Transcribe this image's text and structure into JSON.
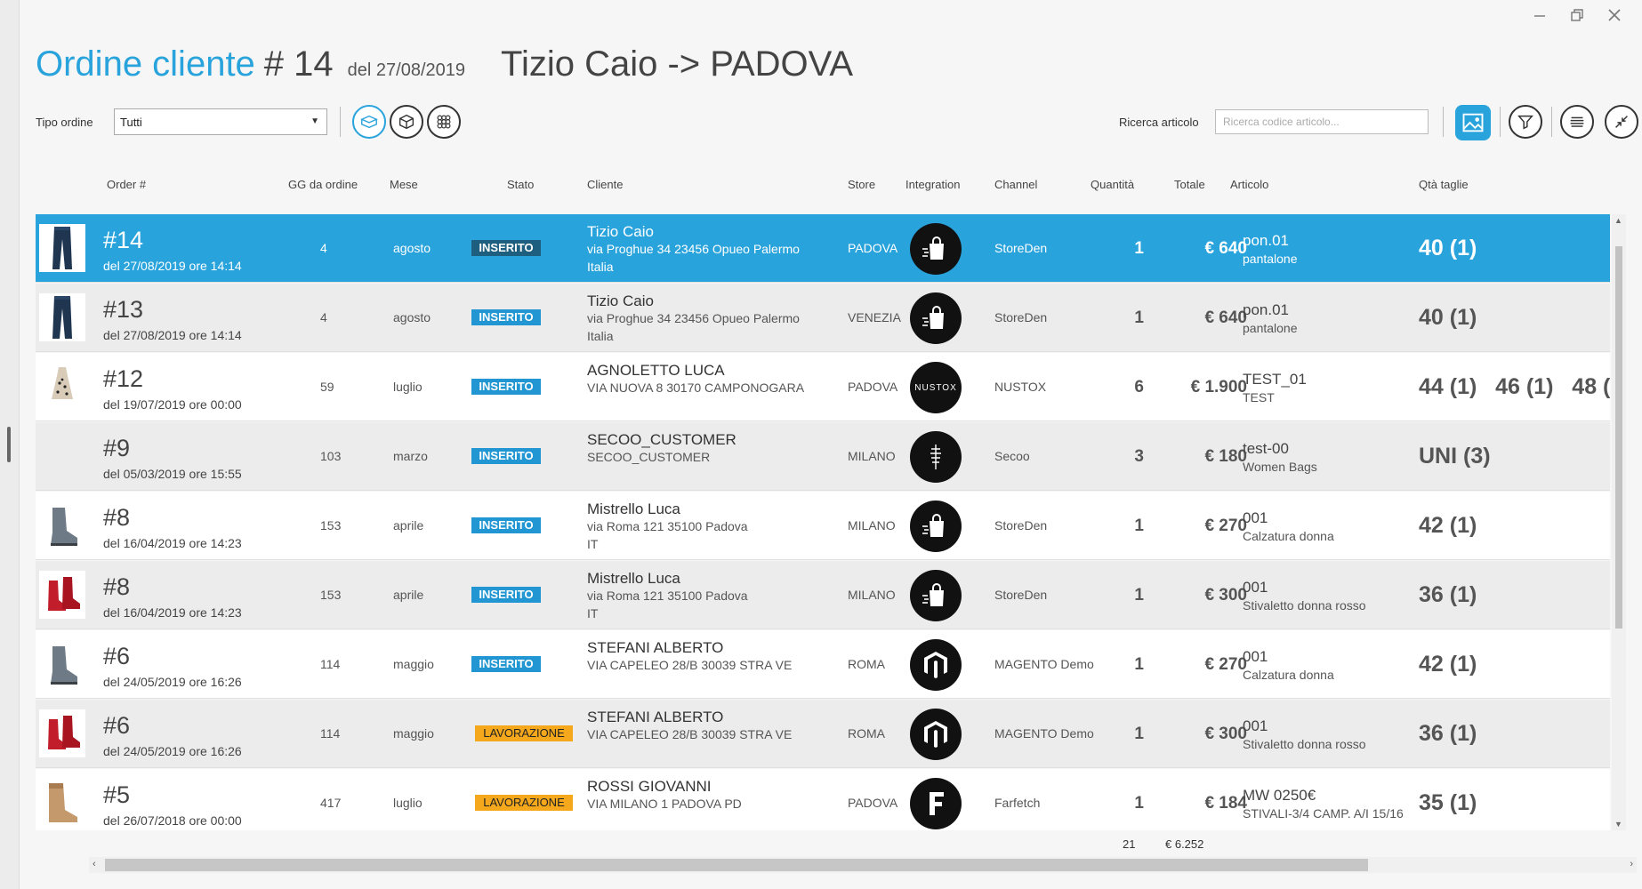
{
  "header": {
    "title": "Ordine cliente",
    "number": "# 14",
    "date": "del 27/08/2019",
    "client": "Tizio Caio -> PADOVA"
  },
  "toolbar": {
    "tipo_label": "Tipo ordine",
    "tipo_value": "Tutti",
    "search_label": "Ricerca articolo",
    "search_placeholder": "Ricerca codice articolo..."
  },
  "columns": {
    "order": "Order #",
    "gg": "GG da ordine",
    "mese": "Mese",
    "stato": "Stato",
    "cliente": "Cliente",
    "store": "Store",
    "integration": "Integration",
    "channel": "Channel",
    "quantita": "Quantità",
    "totale": "Totale",
    "articolo": "Articolo",
    "taglie": "Qtà taglie"
  },
  "rows": [
    {
      "num": "#14",
      "date": "del 27/08/2019 ore 14:14",
      "gg": "4",
      "mese": "agosto",
      "stato": "INSERITO",
      "name": "Tizio Caio",
      "addr": "via Proghue 34 23456 Opueo Palermo",
      "addr2": "Italia",
      "store": "PADOVA",
      "logo": "storeden-icon",
      "channel": "StoreDen",
      "qty": "1",
      "tot": "€ 640",
      "art": "pon.01",
      "art_desc": "pantalone",
      "taglie": "40 (1)",
      "thumb": "jeans-image"
    },
    {
      "num": "#13",
      "date": "del 27/08/2019 ore 14:14",
      "gg": "4",
      "mese": "agosto",
      "stato": "INSERITO",
      "name": "Tizio Caio",
      "addr": "via Proghue 34 23456 Opueo Palermo",
      "addr2": "Italia",
      "store": "VENEZIA",
      "logo": "storeden-icon",
      "channel": "StoreDen",
      "qty": "1",
      "tot": "€ 640",
      "art": "pon.01",
      "art_desc": "pantalone",
      "taglie": "40 (1)",
      "thumb": "jeans-image"
    },
    {
      "num": "#12",
      "date": "del 19/07/2019 ore 00:00",
      "gg": "59",
      "mese": "luglio",
      "stato": "INSERITO",
      "name": "AGNOLETTO LUCA",
      "addr": "VIA NUOVA 8 30170 CAMPONOGARA",
      "addr2": "",
      "store": "PADOVA",
      "logo": "nustox-icon",
      "channel": "NUSTOX",
      "qty": "6",
      "tot": "€ 1.900",
      "art": "TEST_01",
      "art_desc": "TEST",
      "taglie": "44 (1)   46 (1)   48 (",
      "thumb": "dress-image"
    },
    {
      "num": "#9",
      "date": "del 05/03/2019 ore 15:55",
      "gg": "103",
      "mese": "marzo",
      "stato": "INSERITO",
      "name": "SECOO_CUSTOMER",
      "addr": "SECOO_CUSTOMER",
      "addr2": "",
      "store": "MILANO",
      "logo": "secoo-icon",
      "channel": "Secoo",
      "qty": "3",
      "tot": "€ 180",
      "art": "test-00",
      "art_desc": "Women Bags",
      "taglie": "UNI (3)",
      "thumb": ""
    },
    {
      "num": "#8",
      "date": "del 16/04/2019 ore 14:23",
      "gg": "153",
      "mese": "aprile",
      "stato": "INSERITO",
      "name": "Mistrello Luca",
      "addr": "via Roma 121 35100 Padova",
      "addr2": "IT",
      "store": "MILANO",
      "logo": "storeden-icon",
      "channel": "StoreDen",
      "qty": "1",
      "tot": "€ 270",
      "art": "001",
      "art_desc": "Calzatura donna",
      "taglie": "42 (1)",
      "thumb": "grey-boot-image"
    },
    {
      "num": "#8",
      "date": "del 16/04/2019 ore 14:23",
      "gg": "153",
      "mese": "aprile",
      "stato": "INSERITO",
      "name": "Mistrello Luca",
      "addr": "via Roma 121 35100 Padova",
      "addr2": "IT",
      "store": "MILANO",
      "logo": "storeden-icon",
      "channel": "StoreDen",
      "qty": "1",
      "tot": "€ 300",
      "art": "001",
      "art_desc": "Stivaletto donna rosso",
      "taglie": "36 (1)",
      "thumb": "red-boot-image"
    },
    {
      "num": "#6",
      "date": "del 24/05/2019 ore 16:26",
      "gg": "114",
      "mese": "maggio",
      "stato": "INSERITO",
      "name": "STEFANI ALBERTO",
      "addr": "VIA CAPELEO 28/B 30039 STRA VE",
      "addr2": "",
      "store": "ROMA",
      "logo": "magento-icon",
      "channel": "MAGENTO Demo",
      "qty": "1",
      "tot": "€ 270",
      "art": "001",
      "art_desc": "Calzatura donna",
      "taglie": "42 (1)",
      "thumb": "grey-boot-image"
    },
    {
      "num": "#6",
      "date": "del 24/05/2019 ore 16:26",
      "gg": "114",
      "mese": "maggio",
      "stato": "LAVORAZIONE",
      "name": "STEFANI ALBERTO",
      "addr": "VIA CAPELEO 28/B 30039 STRA VE",
      "addr2": "",
      "store": "ROMA",
      "logo": "magento-icon",
      "channel": "MAGENTO Demo",
      "qty": "1",
      "tot": "€ 300",
      "art": "001",
      "art_desc": "Stivaletto donna rosso",
      "taglie": "36 (1)",
      "thumb": "red-boot-image"
    },
    {
      "num": "#5",
      "date": "del 26/07/2018 ore 00:00",
      "gg": "417",
      "mese": "luglio",
      "stato": "LAVORAZIONE",
      "name": "ROSSI GIOVANNI",
      "addr": "VIA MILANO 1  PADOVA PD",
      "addr2": "",
      "store": "PADOVA",
      "logo": "farfetch-icon",
      "channel": "Farfetch",
      "qty": "1",
      "tot": "€ 184",
      "art": "MW 0250€",
      "art_desc": "STIVALI-3/4  CAMP. A/I 15/16",
      "taglie": "35 (1)",
      "thumb": "tan-boot-image"
    }
  ],
  "totals": {
    "qty": "21",
    "tot": "€ 6.252"
  },
  "colors": {
    "accent": "#29a3dc",
    "inserito": "#2196d3",
    "lavorazione": "#f5a81c"
  }
}
